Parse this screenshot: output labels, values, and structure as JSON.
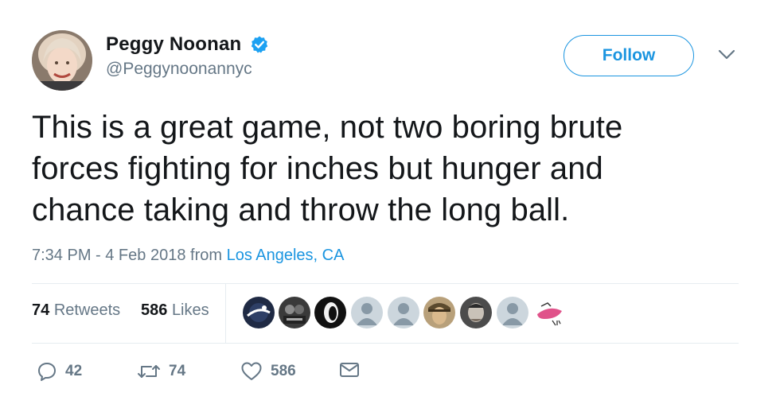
{
  "author": {
    "name": "Peggy Noonan",
    "handle": "@Peggynoonannyc",
    "verified": true
  },
  "follow_button": {
    "label": "Follow"
  },
  "tweet": {
    "text_lines": [
      "This is a great game, not two boring brute",
      "forces fighting for inches but hunger and",
      "chance taking and throw the long ball."
    ],
    "timestamp": "7:34 PM - 4 Feb 2018",
    "from_label": "from",
    "location": "Los Angeles, CA"
  },
  "stats": {
    "retweets_count": "74",
    "retweets_label": "Retweets",
    "likes_count": "586",
    "likes_label": "Likes"
  },
  "actions": {
    "reply_count": "42",
    "retweet_count": "74",
    "like_count": "586"
  },
  "colors": {
    "accent": "#1b95e0",
    "secondary_text": "#657786",
    "divider": "#e6ecf0"
  }
}
